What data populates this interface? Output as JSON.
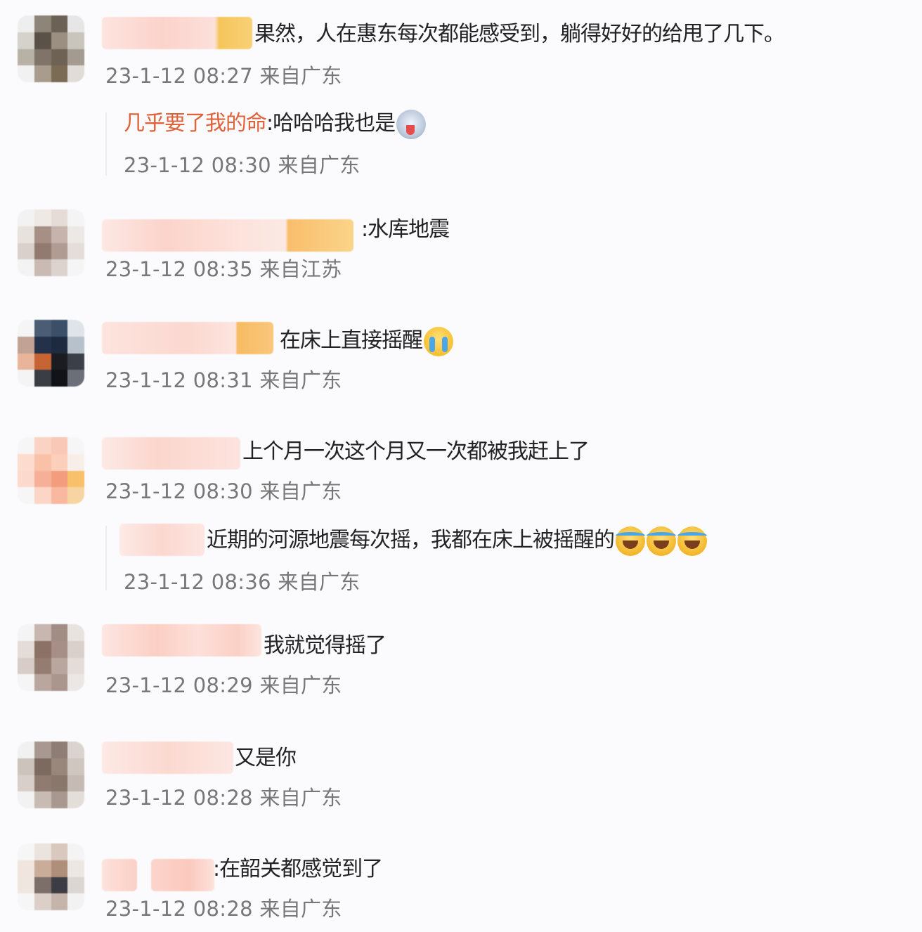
{
  "comments": [
    {
      "text": "果然，人在惠东每次都能感受到，躺得好好的给甩了几下。",
      "meta": "23-1-12 08:27 来自广东",
      "replies": [
        {
          "name": "几乎要了我的命",
          "text": ":哈哈哈我也是",
          "meta": "23-1-12 08:30 来自广东",
          "emoji": "husky-icon"
        }
      ]
    },
    {
      "text": ":水库地震",
      "meta": "23-1-12 08:35 来自江苏"
    },
    {
      "text": "在床上直接摇醒",
      "meta": "23-1-12 08:31 来自广东",
      "emoji": "crying-face-icon"
    },
    {
      "text": "上个月一次这个月又一次都被我赶上了",
      "meta": "23-1-12 08:30 来自广东",
      "replies": [
        {
          "text": "近期的河源地震每次摇，我都在床上被摇醒的",
          "meta": "23-1-12 08:36 来自广东",
          "emoji": "laughing-crying-face-icon"
        }
      ]
    },
    {
      "text": "我就觉得摇了",
      "meta": "23-1-12 08:29 来自广东"
    },
    {
      "text": "又是你",
      "meta": "23-1-12 08:28 来自广东"
    },
    {
      "text": ":在韶关都感觉到了",
      "meta": "23-1-12 08:28 来自广东"
    }
  ],
  "colors": {
    "background": "#fbfbfd",
    "reply_name": "#e0623a",
    "meta_text": "#777777"
  }
}
